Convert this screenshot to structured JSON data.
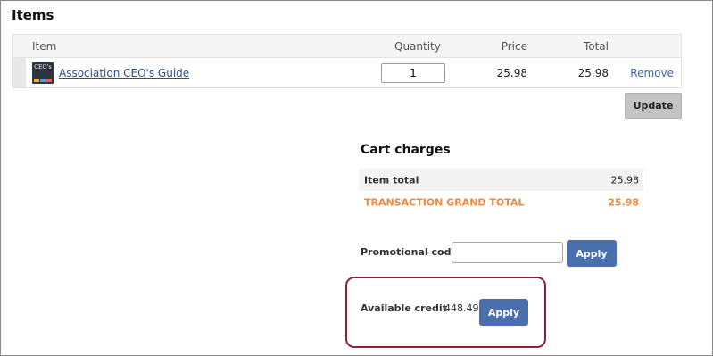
{
  "items_section": {
    "title": "Items",
    "columns": {
      "item": "Item",
      "quantity": "Quantity",
      "price": "Price",
      "total": "Total"
    },
    "rows": [
      {
        "thumbnail_text": "CEO's",
        "name": "Association CEO's Guide",
        "quantity": "1",
        "price": "25.98",
        "total": "25.98",
        "remove_label": "Remove"
      }
    ],
    "update_label": "Update"
  },
  "cart_charges": {
    "title": "Cart charges",
    "item_total_label": "Item total",
    "item_total_value": "25.98",
    "grand_total_label": "TRANSACTION GRAND TOTAL",
    "grand_total_value": "25.98",
    "grand_total_color": "#f0883e"
  },
  "promo": {
    "label": "Promotional code",
    "value": "",
    "apply_label": "Apply"
  },
  "credit": {
    "label": "Available credit",
    "value": "448.49",
    "apply_label": "Apply",
    "highlight_color": "#8c2233"
  },
  "colors": {
    "primary_button": "#4a6fad",
    "link": "#2c4f8a",
    "secondary_button": "#c4c4c4"
  }
}
